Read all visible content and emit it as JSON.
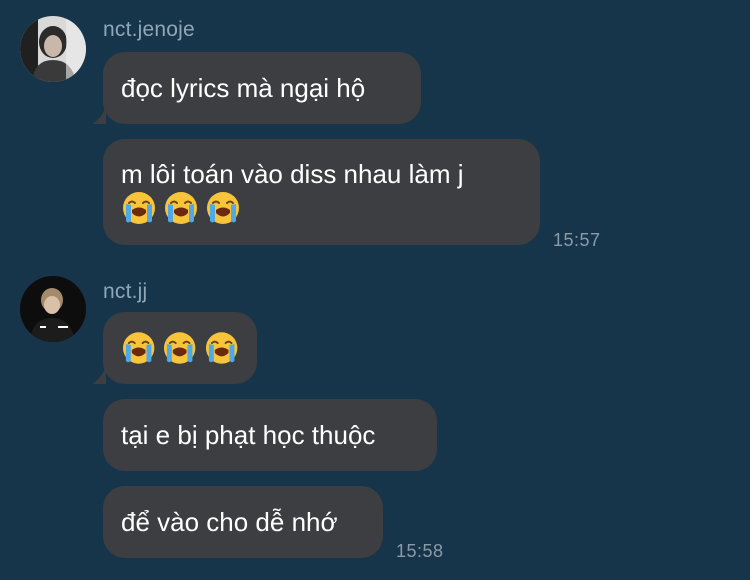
{
  "groups": [
    {
      "sender": "nct.jenoje",
      "avatar": "avatar-person-photo",
      "messages": [
        {
          "text": "đọc lyrics mà ngại hộ"
        },
        {
          "text": "m lôi toán vào diss nhau làm j",
          "emoji": [
            "loudly-crying-face",
            "loudly-crying-face",
            "loudly-crying-face"
          ]
        }
      ],
      "time": "15:57"
    },
    {
      "sender": "nct.jj",
      "avatar": "avatar-person-photo",
      "messages": [
        {
          "emoji": [
            "loudly-crying-face",
            "loudly-crying-face",
            "loudly-crying-face"
          ]
        },
        {
          "text": "tại e bị phạt học thuộc"
        },
        {
          "text": "để vào cho dễ nhớ"
        }
      ],
      "time": "15:58"
    }
  ],
  "colors": {
    "background": "#17354a",
    "bubble": "#3d3e42",
    "sender_name": "#8fa6b6",
    "timestamp": "#8a9aa6"
  }
}
